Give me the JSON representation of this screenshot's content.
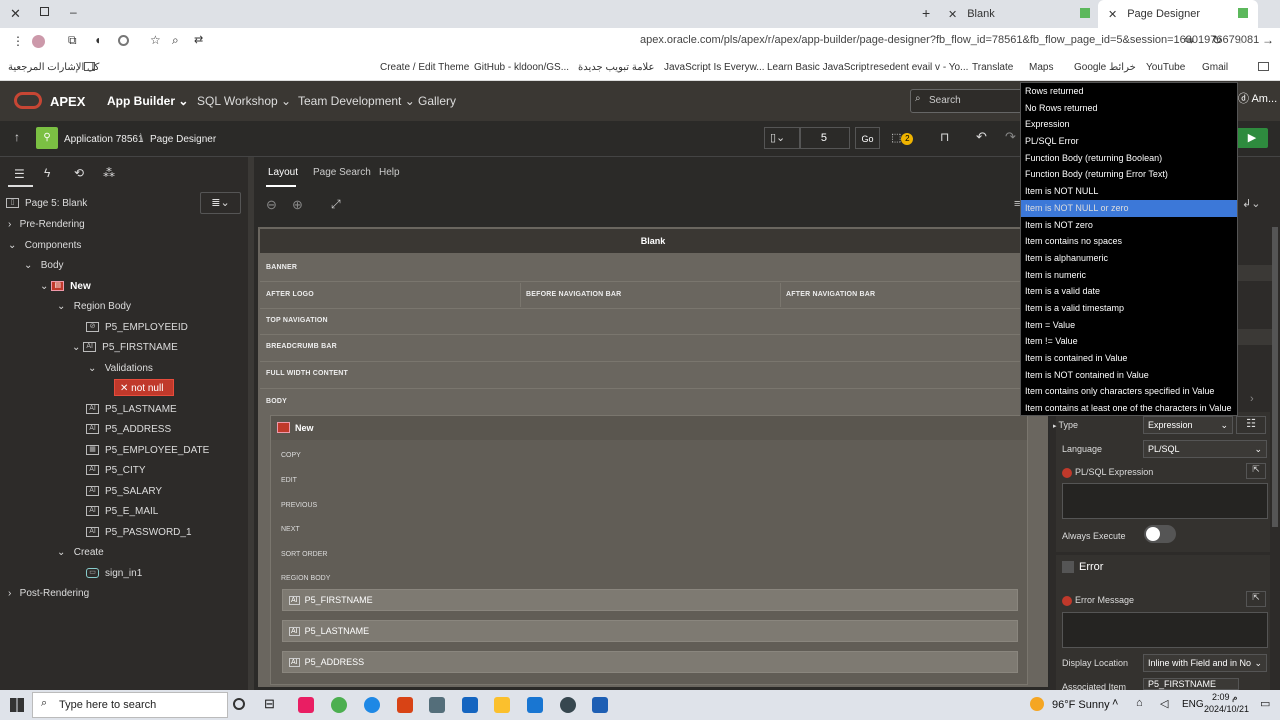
{
  "browser": {
    "tabs": [
      {
        "label": "Blank"
      },
      {
        "label": "Page Designer"
      }
    ],
    "url": "apex.oracle.com/pls/apex/r/apex/app-builder/page-designer?fb_flow_id=78561&fb_flow_page_id=5&session=16301976679081",
    "bookmarks": [
      "كل الإشارات المرجعية",
      "Create / Edit Theme",
      "GitHub - kldoon/GS...",
      "علامة تبويب جديدة",
      "JavaScript Is Everyw...",
      "Learn Basic JavaScript",
      "resedent evail v - Yo...",
      "Translate",
      "Maps",
      "Google خرائط",
      "YouTube",
      "Gmail"
    ]
  },
  "apex": {
    "logo": "APEX",
    "nav": [
      "App Builder",
      "SQL Workshop",
      "Team Development",
      "Gallery"
    ],
    "search_placeholder": "Search",
    "user": "Am...",
    "crumb_app": "Application 78561",
    "crumb_page": "Page Designer",
    "page_number": "5",
    "go": "Go",
    "badge": "2"
  },
  "tree": {
    "page": "Page 5: Blank",
    "pre": "Pre-Rendering",
    "components": "Components",
    "body": "Body",
    "region": "New",
    "region_body": "Region Body",
    "items1": [
      "P5_EMPLOYEEID",
      "P5_FIRSTNAME"
    ],
    "validations": "Validations",
    "validation_name": "not null",
    "items2": [
      "P5_LASTNAME",
      "P5_ADDRESS",
      "P5_EMPLOYEE_DATE",
      "P5_CITY",
      "P5_SALARY",
      "P5_E_MAIL",
      "P5_PASSWORD_1"
    ],
    "create": "Create",
    "sign": "sign_in1",
    "post": "Post-Rendering"
  },
  "center": {
    "tabs": [
      "Layout",
      "Page Search",
      "Help"
    ],
    "title": "Blank",
    "banner": "BANNER",
    "after_logo": "AFTER LOGO",
    "before_nav": "BEFORE NAVIGATION BAR",
    "after_nav": "AFTER NAVIGATION BAR",
    "top_nav": "TOP NAVIGATION",
    "breadcrumb": "BREADCRUMB BAR",
    "full_width": "FULL WIDTH CONTENT",
    "body": "BODY",
    "region": "New",
    "region_buttons": [
      "COPY",
      "EDIT",
      "PREVIOUS",
      "NEXT",
      "SORT ORDER",
      "REGION BODY"
    ],
    "items": [
      "P5_FIRSTNAME",
      "P5_LASTNAME",
      "P5_ADDRESS"
    ]
  },
  "right": {
    "type_label": "Type",
    "type_value": "Expression",
    "lang_label": "Language",
    "lang_value": "PL/SQL",
    "plsql_label": "PL/SQL Expression",
    "always_label": "Always Execute",
    "error_header": "Error",
    "error_msg_label": "Error Message",
    "display_label": "Display Location",
    "display_value": "Inline with Field and in No",
    "assoc_label": "Associated Item",
    "assoc_value": "P5_FIRSTNAME"
  },
  "dropdown": {
    "options": [
      "Rows returned",
      "No Rows returned",
      "Expression",
      "PL/SQL Error",
      "Function Body (returning Boolean)",
      "Function Body (returning Error Text)",
      "Item is NOT NULL",
      "Item is NOT NULL or zero",
      "Item is NOT zero",
      "Item contains no spaces",
      "Item is alphanumeric",
      "Item is numeric",
      "Item is a valid date",
      "Item is a valid timestamp",
      "Item = Value",
      "Item != Value",
      "Item is contained in Value",
      "Item is NOT contained in Value",
      "Item contains only characters specified in Value",
      "Item contains at least one of the characters in Value"
    ],
    "selected_index": 7
  },
  "taskbar": {
    "search": "Type here to search",
    "weather": "96°F Sunny",
    "lang": "ENG",
    "time": "2:09 م",
    "date": "2024/10/21"
  }
}
